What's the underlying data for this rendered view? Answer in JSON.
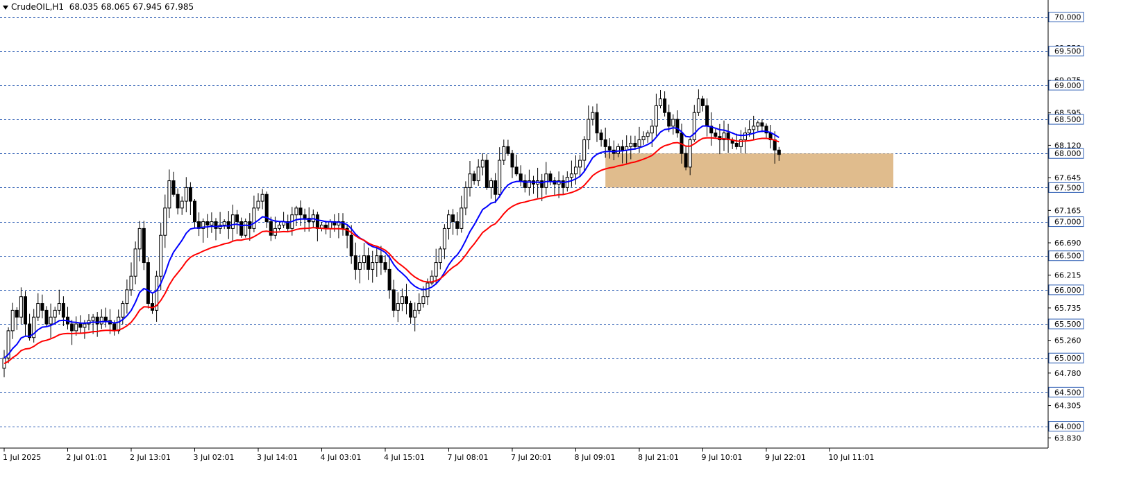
{
  "header": {
    "symbol": "CrudeOIL,H1",
    "ohlc": "68.035 68.065 67.945 67.985"
  },
  "colors": {
    "background": "#ffffff",
    "grid": "#2f5fb4",
    "bull_body": "#ffffff",
    "bear_body": "#000000",
    "ma_fast": "#0000ff",
    "ma_slow": "#ff0000",
    "zone_fill": "#deb887",
    "level_label_border": "#2f5fb4"
  },
  "chart_data": {
    "type": "candlestick",
    "timeframe": "H1",
    "ylim": [
      63.68,
      70.25
    ],
    "y_ticks": [
      "70.000",
      "69.550",
      "69.075",
      "68.595",
      "68.120",
      "67.645",
      "67.165",
      "66.690",
      "66.215",
      "65.735",
      "65.260",
      "64.780",
      "64.305",
      "63.830"
    ],
    "y_tick_values": [
      70.0,
      69.55,
      69.075,
      68.595,
      68.12,
      67.645,
      67.165,
      66.69,
      66.215,
      65.735,
      65.26,
      64.78,
      64.305,
      63.83
    ],
    "levels": [
      {
        "value": 70.0,
        "label": "70.000"
      },
      {
        "value": 69.5,
        "label": "69.500"
      },
      {
        "value": 69.0,
        "label": "69.000"
      },
      {
        "value": 68.5,
        "label": "68.500"
      },
      {
        "value": 68.0,
        "label": "68.000"
      },
      {
        "value": 67.5,
        "label": "67.500"
      },
      {
        "value": 67.0,
        "label": "67.000"
      },
      {
        "value": 66.5,
        "label": "66.500"
      },
      {
        "value": 66.0,
        "label": "66.000"
      },
      {
        "value": 65.5,
        "label": "65.500"
      },
      {
        "value": 65.0,
        "label": "65.000"
      },
      {
        "value": 64.5,
        "label": "64.500"
      },
      {
        "value": 64.0,
        "label": "64.000"
      }
    ],
    "x_labels": [
      {
        "index": 0,
        "label": "1 Jul 2025"
      },
      {
        "index": 15,
        "label": "2 Jul 01:01"
      },
      {
        "index": 30,
        "label": "2 Jul 13:01"
      },
      {
        "index": 45,
        "label": "3 Jul 02:01"
      },
      {
        "index": 60,
        "label": "3 Jul 14:01"
      },
      {
        "index": 75,
        "label": "4 Jul 03:01"
      },
      {
        "index": 90,
        "label": "4 Jul 15:01"
      },
      {
        "index": 105,
        "label": "7 Jul 08:01"
      },
      {
        "index": 120,
        "label": "7 Jul 20:01"
      },
      {
        "index": 135,
        "label": "8 Jul 09:01"
      },
      {
        "index": 150,
        "label": "8 Jul 21:01"
      },
      {
        "index": 165,
        "label": "9 Jul 10:01"
      },
      {
        "index": 180,
        "label": "9 Jul 22:01"
      },
      {
        "index": 195,
        "label": "10 Jul 11:01"
      }
    ],
    "zone": {
      "from_index": 142,
      "to_index": 210,
      "top": 68.0,
      "bottom": 67.5
    },
    "closes": [
      65.0,
      65.4,
      65.7,
      65.6,
      65.9,
      65.5,
      65.3,
      65.6,
      65.8,
      65.7,
      65.5,
      65.6,
      65.7,
      65.8,
      65.6,
      65.5,
      65.4,
      65.5,
      65.45,
      65.5,
      65.55,
      65.6,
      65.5,
      65.6,
      65.55,
      65.5,
      65.4,
      65.6,
      65.8,
      66.0,
      66.2,
      66.6,
      66.9,
      66.4,
      65.8,
      65.7,
      66.2,
      66.8,
      67.2,
      67.6,
      67.4,
      67.2,
      67.3,
      67.5,
      67.3,
      67.0,
      66.9,
      67.0,
      66.95,
      67.0,
      66.9,
      66.95,
      67.0,
      66.9,
      67.1,
      67.0,
      66.8,
      67.0,
      66.9,
      67.2,
      67.3,
      67.4,
      67.0,
      66.8,
      66.9,
      66.95,
      67.0,
      66.9,
      67.1,
      67.2,
      67.1,
      67.05,
      67.0,
      67.1,
      66.9,
      66.95,
      66.9,
      67.0,
      66.95,
      67.0,
      66.9,
      66.8,
      66.5,
      66.3,
      66.4,
      66.5,
      66.3,
      66.4,
      66.5,
      66.4,
      66.3,
      66.0,
      65.7,
      65.8,
      65.9,
      65.8,
      65.6,
      65.7,
      65.8,
      65.9,
      66.1,
      66.2,
      66.4,
      66.6,
      66.9,
      67.1,
      67.0,
      66.9,
      67.2,
      67.5,
      67.7,
      67.6,
      67.8,
      67.9,
      67.5,
      67.6,
      67.4,
      67.9,
      68.1,
      68.0,
      67.8,
      67.7,
      67.6,
      67.5,
      67.6,
      67.55,
      67.6,
      67.5,
      67.7,
      67.6,
      67.55,
      67.6,
      67.5,
      67.65,
      67.7,
      67.8,
      67.9,
      68.2,
      68.5,
      68.6,
      68.3,
      68.2,
      68.1,
      68.05,
      68.0,
      68.1,
      68.05,
      68.1,
      68.15,
      68.1,
      68.2,
      68.25,
      68.3,
      68.4,
      68.7,
      68.8,
      68.6,
      68.4,
      68.5,
      68.3,
      68.0,
      67.8,
      68.2,
      68.6,
      68.8,
      68.7,
      68.4,
      68.3,
      68.25,
      68.2,
      68.3,
      68.2,
      68.15,
      68.1,
      68.2,
      68.3,
      68.35,
      68.4,
      68.45,
      68.4,
      68.3,
      68.2,
      68.05,
      67.985
    ],
    "ma_fast_label": "",
    "ma_slow_label": ""
  }
}
